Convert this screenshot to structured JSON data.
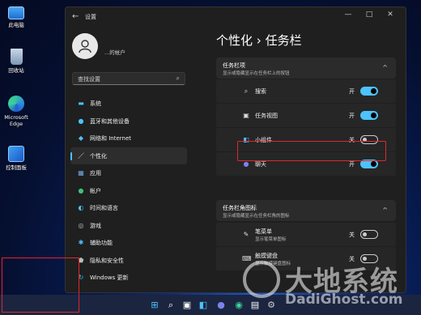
{
  "desktop": {
    "icons": [
      {
        "label": "此电脑",
        "icon": "computer-icon"
      },
      {
        "label": "回收站",
        "icon": "recycle-bin-icon"
      },
      {
        "label": "Microsoft Edge",
        "icon": "edge-icon"
      },
      {
        "label": "控制面板",
        "icon": "control-panel-icon"
      }
    ]
  },
  "window": {
    "title": "设置",
    "back_glyph": "←",
    "controls": [
      "—",
      "□",
      "✕"
    ]
  },
  "profile": {
    "name": "...的帐户"
  },
  "search": {
    "placeholder": "查找设置",
    "icon": "search-icon"
  },
  "nav": {
    "items": [
      {
        "label": "系统",
        "icon": "monitor-icon",
        "color": "#4cc2ff"
      },
      {
        "label": "蓝牙和其他设备",
        "icon": "bluetooth-icon",
        "color": "#4cc2ff"
      },
      {
        "label": "网络和 Internet",
        "icon": "wifi-icon",
        "color": "#4cc2ff"
      },
      {
        "label": "个性化",
        "icon": "brush-icon",
        "color": "#e8e8e8",
        "active": true
      },
      {
        "label": "应用",
        "icon": "apps-icon",
        "color": "#6fa8dc"
      },
      {
        "label": "帐户",
        "icon": "person-icon",
        "color": "#3ec27a"
      },
      {
        "label": "时间和语言",
        "icon": "globe-clock-icon",
        "color": "#4cc2ff"
      },
      {
        "label": "游戏",
        "icon": "gamepad-icon",
        "color": "#bbb"
      },
      {
        "label": "辅助功能",
        "icon": "accessibility-icon",
        "color": "#4cc2ff"
      },
      {
        "label": "隐私和安全性",
        "icon": "shield-icon",
        "color": "#bbb"
      },
      {
        "label": "Windows 更新",
        "icon": "update-icon",
        "color": "#4cc2ff"
      }
    ]
  },
  "main": {
    "breadcrumb_parent": "个性化",
    "breadcrumb_sep": "›",
    "breadcrumb_current": "任务栏",
    "section1": {
      "title": "任务栏项",
      "subtitle": "显示或隐藏显示在任务栏上的按钮",
      "chevron": "^"
    },
    "rows1": [
      {
        "label": "搜索",
        "icon": "search-icon",
        "value": "开",
        "on": true
      },
      {
        "label": "任务视图",
        "icon": "task-view-icon",
        "value": "开",
        "on": true
      },
      {
        "label": "小组件",
        "icon": "widgets-icon",
        "value": "关",
        "on": false
      },
      {
        "label": "聊天",
        "icon": "chat-icon",
        "value": "开",
        "on": true
      }
    ],
    "section2": {
      "title": "任务栏角图标",
      "subtitle": "显示或隐藏显示在任务栏角的图标",
      "chevron": "^"
    },
    "rows2": [
      {
        "label": "笔菜单",
        "sub": "显示笔菜单图标",
        "icon": "pen-icon",
        "value": "关",
        "on": false
      },
      {
        "label": "触摸键盘",
        "sub": "显示触摸键盘图标",
        "icon": "keyboard-icon",
        "value": "关",
        "on": false
      }
    ]
  },
  "taskbar": {
    "icons": [
      "windows-start-icon",
      "search-icon",
      "task-view-icon",
      "widgets-icon",
      "chat-icon",
      "edge-icon",
      "store-icon",
      "settings-icon"
    ]
  },
  "watermark": {
    "big": "大地系统",
    "small": "DadiGhost.com"
  },
  "colors": {
    "accent": "#4cc2ff",
    "highlight": "#e0262b",
    "window_bg": "#1f1f1f"
  }
}
